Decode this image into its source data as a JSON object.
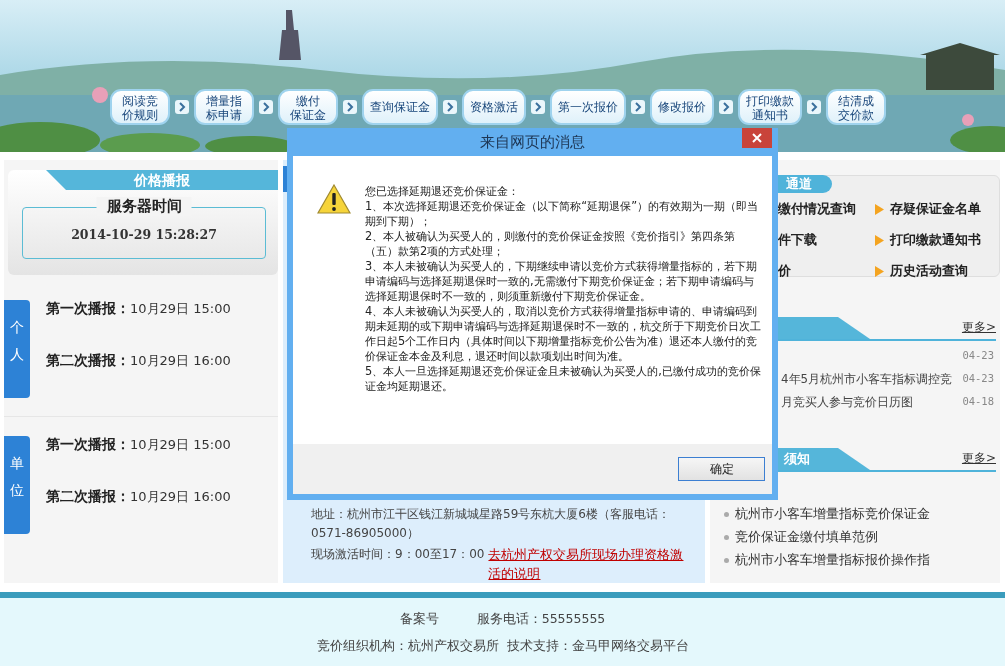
{
  "banner": {
    "steps": [
      {
        "lines": [
          "阅读竞",
          "价规则"
        ]
      },
      {
        "lines": [
          "增量指",
          "标申请"
        ]
      },
      {
        "lines": [
          "缴付",
          "保证金"
        ]
      },
      {
        "lines": [
          "查询保证金"
        ]
      },
      {
        "lines": [
          "资格激活"
        ]
      },
      {
        "lines": [
          "第一次报价"
        ]
      },
      {
        "lines": [
          "修改报价"
        ]
      },
      {
        "lines": [
          "打印缴款",
          "通知书"
        ]
      },
      {
        "lines": [
          "结清成",
          "交价款"
        ]
      }
    ]
  },
  "price_broadcast": {
    "title": "价格播报",
    "server_time_label": "服务器时间",
    "server_time": "2014-10-29 15:28:27",
    "groups": [
      {
        "label": "个人",
        "rows": [
          {
            "label": "第一次播报：",
            "time": "10月29日 15:00"
          },
          {
            "label": "第二次播报：",
            "time": "10月29日 16:00"
          }
        ]
      },
      {
        "label": "单位",
        "rows": [
          {
            "label": "第一次播报：",
            "time": "10月29日 15:00"
          },
          {
            "label": "第二次播报：",
            "time": "10月29日 16:00"
          }
        ]
      }
    ]
  },
  "middle_panel": {
    "address": "地址：杭州市江干区钱江新城城星路59号东杭大厦6楼（客服电话：0571-86905000）",
    "activation_time": "现场激活时间：9：00至17：00",
    "activation_link": "去杭州产权交易所现场办理资格激活的说明"
  },
  "quick_channel": {
    "title": "通道",
    "left_column": [
      "缴付情况查询",
      "件下载",
      "价"
    ],
    "right_column": [
      "存疑保证金名单",
      "打印缴款通知书",
      "历史活动查询"
    ]
  },
  "news": {
    "more": "更多>",
    "items": [
      {
        "date": "04-23"
      },
      {
        "title": "4年5月杭州市小客车指标调控竞",
        "date": "04-23"
      },
      {
        "title": "月竞买人参与竞价日历图",
        "date": "04-18"
      }
    ]
  },
  "notices": {
    "title": "须知",
    "more": "更多>",
    "items": [
      "杭州市小客车增量指标竞价保证金",
      "竞价保证金缴付填单范例",
      "杭州市小客车增量指标报价操作指"
    ]
  },
  "footer": {
    "lines": [
      [
        "备案号",
        "服务电话：55555555"
      ],
      [
        "竞价组织机构：杭州产权交易所",
        "技术支持：金马甲网络交易平台"
      ]
    ]
  },
  "dialog": {
    "title": "来自网页的消息",
    "paragraphs": [
      "您已选择延期退还竞价保证金：",
      "1、本次选择延期退还竞价保证金（以下简称“延期退保”）的有效期为一期（即当期到下期）；",
      "2、本人被确认为买受人的，则缴付的竞价保证金按照《竞价指引》第四条第（五）款第2项的方式处理；",
      "3、本人未被确认为买受人的，下期继续申请以竞价方式获得增量指标的，若下期申请编码与选择延期退保时一致的,无需缴付下期竞价保证金；若下期申请编码与选择延期退保时不一致的，则须重新缴付下期竞价保证金。",
      "4、本人未被确认为买受人的，取消以竞价方式获得增量指标申请的、申请编码到期未延期的或下期申请编码与选择延期退保时不一致的，杭交所于下期竞价日次工作日起5个工作日内（具体时间以下期增量指标竞价公告为准）退还本人缴付的竞价保证金本金及利息，退还时间以款项划出时间为准。",
      "5、本人一旦选择延期退还竞价保证金且未被确认为买受人的,已缴付成功的竞价保证金均延期退还。"
    ],
    "ok_button": "确定"
  }
}
